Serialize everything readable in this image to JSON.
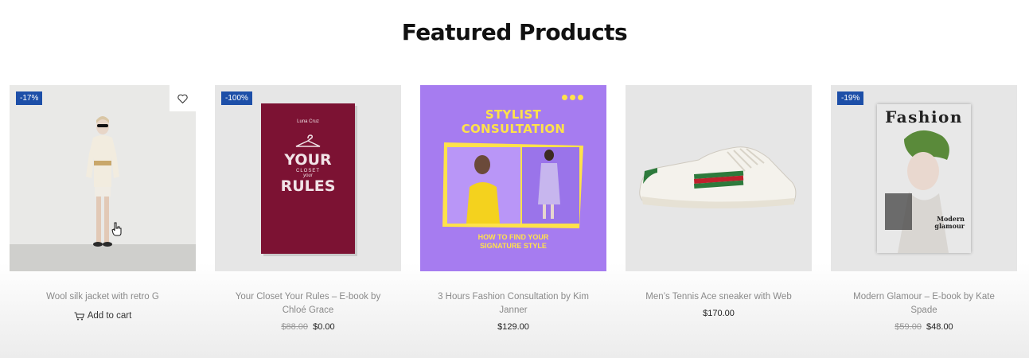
{
  "section": {
    "title": "Featured Products"
  },
  "products": [
    {
      "badge": "-17%",
      "name": "Wool silk jacket with retro G",
      "action_label": "Add to cart"
    },
    {
      "badge": "-100%",
      "name": "Your Closet Your Rules – E-book by Chloé Grace",
      "old_price": "$88.00",
      "price": "$0.00",
      "cover": {
        "author": "Luna Cruz",
        "line1": "YOUR",
        "line2": "CLOSET",
        "line3": "your",
        "line4": "RULES"
      }
    },
    {
      "name": "3 Hours Fashion Consultation by Kim Janner",
      "price": "$129.00",
      "cover": {
        "title_line1": "STYLIST",
        "title_line2": "CONSULTATION",
        "subtitle_line1": "HOW TO FIND YOUR",
        "subtitle_line2": "SIGNATURE STYLE"
      }
    },
    {
      "name": "Men’s Tennis Ace sneaker with Web",
      "price": "$170.00"
    },
    {
      "badge": "-19%",
      "name": "Modern Glamour – E-book by Kate Spade",
      "old_price": "$59.00",
      "price": "$48.00",
      "cover": {
        "brand": "Fashion",
        "tag_line1": "Modern",
        "tag_line2": "glamour"
      }
    }
  ],
  "colors": {
    "badge": "#1d4fa8",
    "book": "#7c1233",
    "consult_bg": "#a67cf0",
    "consult_text": "#ffe24a"
  }
}
